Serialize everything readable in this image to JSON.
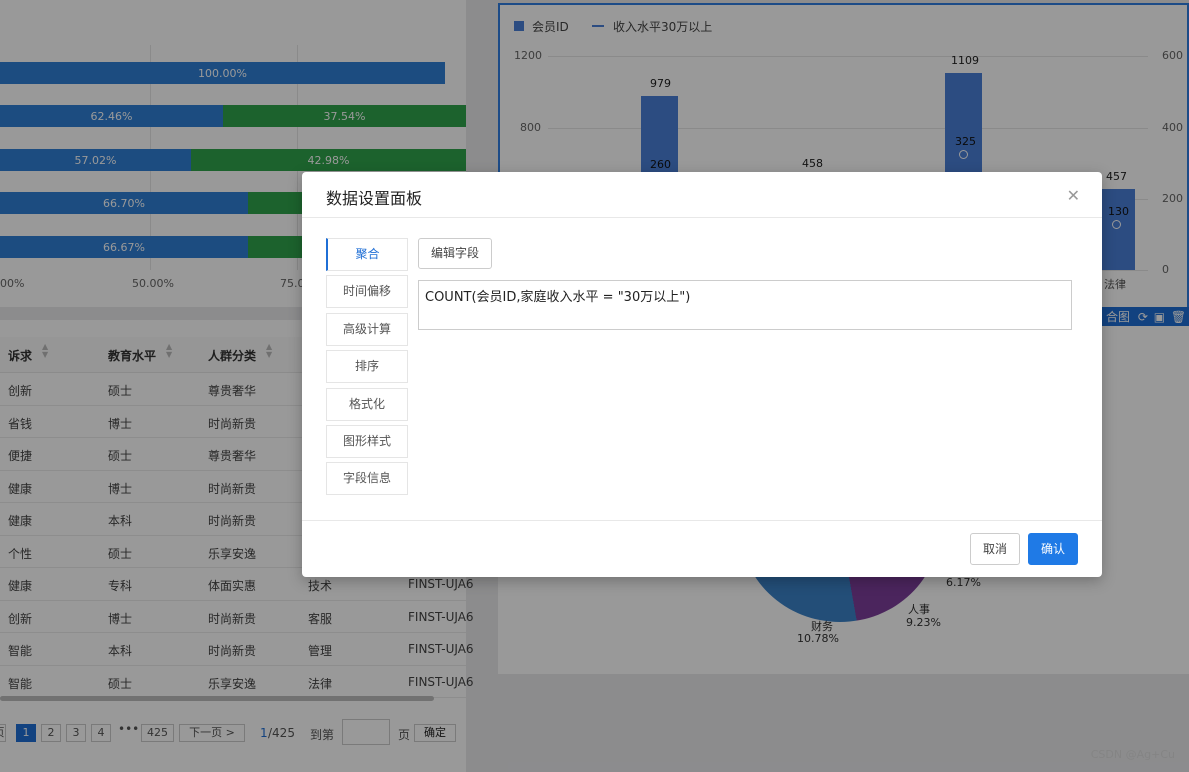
{
  "stacked_chart": {
    "rows": [
      {
        "blue": 100.0,
        "blue_label": "100.00%",
        "green": 0,
        "green_label": ""
      },
      {
        "blue": 62.46,
        "blue_label": "62.46%",
        "green": 37.54,
        "green_label": "37.54%"
      },
      {
        "blue": 57.02,
        "blue_label": "57.02%",
        "green": 42.98,
        "green_label": "42.98%"
      },
      {
        "blue": 66.7,
        "blue_label": "66.70%",
        "green": 33.3,
        "green_label": ""
      },
      {
        "blue": 66.67,
        "blue_label": "66.67%",
        "green": 33.33,
        "green_label": ""
      }
    ],
    "xticks": [
      "00%",
      "50.00%",
      "75.00"
    ],
    "colors": {
      "blue": "#2f7fd6",
      "green": "#2fa44c"
    }
  },
  "table": {
    "headers": [
      "诉求",
      "教育水平",
      "人群分类"
    ],
    "rows": [
      [
        "创新",
        "硕士",
        "尊贵奢华",
        "",
        ""
      ],
      [
        "省钱",
        "博士",
        "时尚新贵",
        "",
        ""
      ],
      [
        "便捷",
        "硕士",
        "尊贵奢华",
        "",
        ""
      ],
      [
        "健康",
        "博士",
        "时尚新贵",
        "",
        ""
      ],
      [
        "健康",
        "本科",
        "时尚新贵",
        "",
        ""
      ],
      [
        "个性",
        "硕士",
        "乐享安逸",
        "",
        ""
      ],
      [
        "健康",
        "专科",
        "体面实惠",
        "技术",
        "FINST-UJA6"
      ],
      [
        "创新",
        "博士",
        "时尚新贵",
        "客服",
        "FINST-UJA6"
      ],
      [
        "智能",
        "本科",
        "时尚新贵",
        "管理",
        "FINST-UJA6"
      ],
      [
        "智能",
        "硕士",
        "乐享安逸",
        "法律",
        "FINST-UJA6"
      ]
    ]
  },
  "pagination": {
    "pages": [
      "1",
      "2",
      "3",
      "4"
    ],
    "ellipsis": "•••",
    "last": "425",
    "next": "下一页 >",
    "current_current": "1",
    "current_total": "/425",
    "goto": "到第",
    "page_suffix": "页",
    "confirm": "确定"
  },
  "bar_chart": {
    "legend": [
      {
        "label": "会员ID",
        "type": "bar"
      },
      {
        "label": "收入水平30万以上",
        "type": "line"
      }
    ],
    "left_axis": [
      "1200",
      "800"
    ],
    "right_axis": [
      "600",
      "400",
      "200",
      "0"
    ],
    "bars": [
      {
        "value": "979",
        "inner": "260"
      },
      {
        "value": "458",
        "inner": ""
      },
      {
        "value": "1109",
        "inner": "325"
      },
      {
        "value": "457",
        "inner": "130"
      }
    ],
    "last_category": "法律",
    "toolbar_label": "合图",
    "bar_color": "#4a7fd8"
  },
  "pie_chart": {
    "labels": [
      {
        "name": "",
        "pct": "6.17%"
      },
      {
        "name": "人事",
        "pct": "9.23%"
      },
      {
        "name": "财务",
        "pct": "10.78%"
      }
    ]
  },
  "dialog": {
    "title": "数据设置面板",
    "close_icon": "close-icon",
    "tabs": [
      "聚合",
      "时间偏移",
      "高级计算",
      "排序",
      "格式化",
      "图形样式",
      "字段信息"
    ],
    "active_tab": 0,
    "edit_field_label": "编辑字段",
    "formula": "COUNT(会员ID,家庭收入水平 = \"30万以上\")",
    "cancel_label": "取消",
    "ok_label": "确认"
  },
  "watermark": "CSDN @Ag+Cu"
}
